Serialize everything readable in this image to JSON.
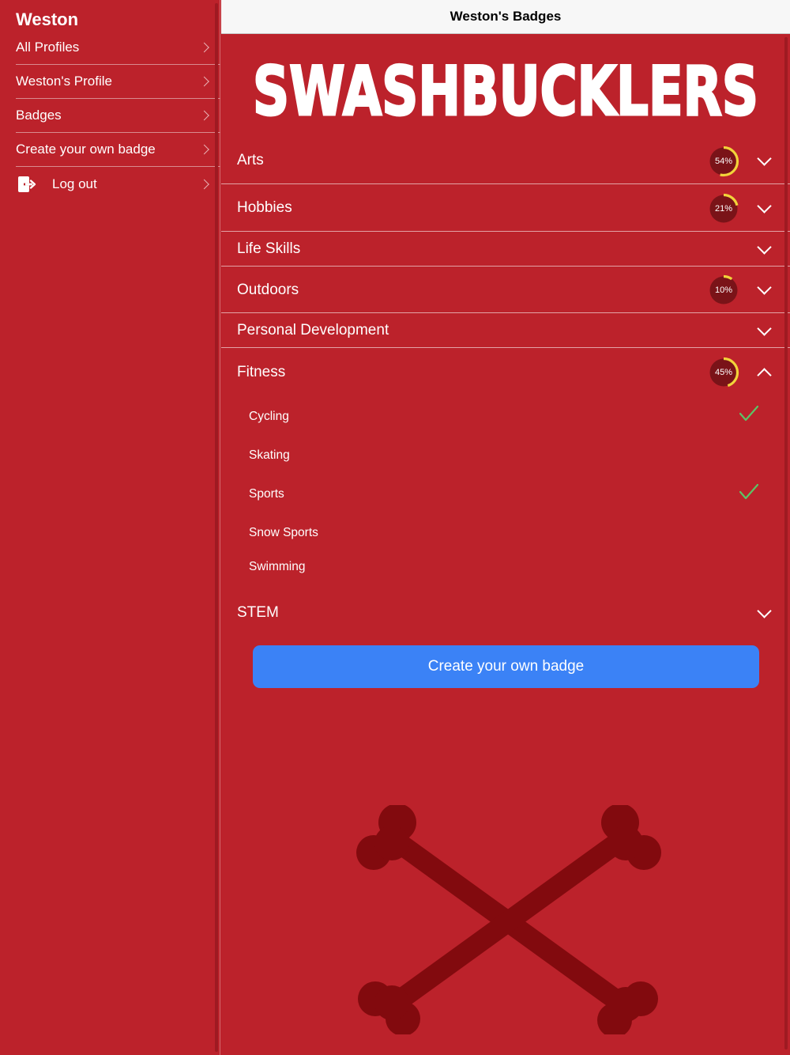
{
  "sidebar": {
    "title": "Weston",
    "items": [
      {
        "label": "All Profiles"
      },
      {
        "label": "Weston's Profile"
      },
      {
        "label": "Badges"
      },
      {
        "label": "Create your own badge"
      },
      {
        "label": "Log out",
        "icon": "logout-icon"
      }
    ]
  },
  "header": {
    "title": "Weston's Badges"
  },
  "logo": {
    "text": "SWASHBUCKLERS"
  },
  "categories": [
    {
      "label": "Arts",
      "progress": 54,
      "progress_text": "54%",
      "expanded": false
    },
    {
      "label": "Hobbies",
      "progress": 21,
      "progress_text": "21%",
      "expanded": false
    },
    {
      "label": "Life Skills",
      "expanded": false
    },
    {
      "label": "Outdoors",
      "progress": 10,
      "progress_text": "10%",
      "expanded": false
    },
    {
      "label": "Personal Development",
      "expanded": false
    },
    {
      "label": "Fitness",
      "progress": 45,
      "progress_text": "45%",
      "expanded": true,
      "badges": [
        {
          "label": "Cycling",
          "completed": true
        },
        {
          "label": "Skating",
          "completed": false
        },
        {
          "label": "Sports",
          "completed": true
        },
        {
          "label": "Snow Sports",
          "completed": false
        },
        {
          "label": "Swimming",
          "completed": false
        }
      ]
    },
    {
      "label": "STEM",
      "expanded": false
    }
  ],
  "create_button": {
    "label": "Create your own badge"
  },
  "colors": {
    "background": "#bc222b",
    "accent_button": "#3b82f6",
    "progress_ring": "#f2d33a",
    "check": "#5cc466",
    "watermark": "#820a0e"
  },
  "decor": {
    "watermark_icon": "crossbones-icon"
  }
}
